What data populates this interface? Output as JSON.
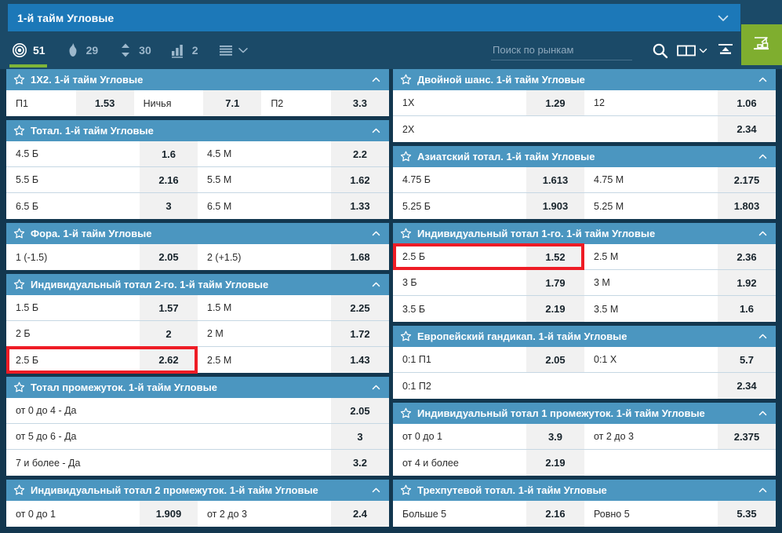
{
  "header": {
    "title": "1-й тайм Угловые",
    "chevron_icon": "chevron-down-icon",
    "tools": [
      {
        "icon": "target-icon",
        "count": "51",
        "active": true
      },
      {
        "icon": "flame-icon",
        "count": "29",
        "active": false
      },
      {
        "icon": "updown-arrows-icon",
        "count": "30",
        "active": false
      },
      {
        "icon": "bar-chart-icon",
        "count": "2",
        "active": false
      }
    ],
    "menu_icon": "hamburger-icon",
    "menu_chevron_icon": "chevron-down-icon",
    "search": {
      "placeholder": "Поиск по рынкам",
      "value": ""
    },
    "search_icon": "search-icon",
    "layout_icon": "two-column-layout-icon",
    "layout_chevron_icon": "chevron-down-icon",
    "collapse_all_icon": "collapse-all-icon",
    "brand_icon": "crane-icon",
    "colors": {
      "bar_bg": "#1b4a68",
      "title_bg": "#1c78b8",
      "accent_green": "#7fb539",
      "brand_green": "#7fae2f",
      "market_header": "#4b96c0",
      "highlight_red": "#ee1c25"
    }
  },
  "left_column": [
    {
      "title": "1X2. 1-й тайм Угловые",
      "layout": "third",
      "rows": [
        [
          {
            "label": "П1",
            "odds": "1.53"
          },
          {
            "label": "Ничья",
            "odds": "7.1"
          },
          {
            "label": "П2",
            "odds": "3.3"
          }
        ]
      ]
    },
    {
      "title": "Тотал. 1-й тайм Угловые",
      "layout": "half",
      "rows": [
        [
          {
            "label": "4.5 Б",
            "odds": "1.6"
          },
          {
            "label": "4.5 М",
            "odds": "2.2"
          }
        ],
        [
          {
            "label": "5.5 Б",
            "odds": "2.16"
          },
          {
            "label": "5.5 М",
            "odds": "1.62"
          }
        ],
        [
          {
            "label": "6.5 Б",
            "odds": "3"
          },
          {
            "label": "6.5 М",
            "odds": "1.33"
          }
        ]
      ]
    },
    {
      "title": "Фора. 1-й тайм Угловые",
      "layout": "half",
      "rows": [
        [
          {
            "label": "1 (-1.5)",
            "odds": "2.05"
          },
          {
            "label": "2 (+1.5)",
            "odds": "1.68"
          }
        ]
      ]
    },
    {
      "title": "Индивидуальный тотал 2-го. 1-й тайм Угловые",
      "layout": "half",
      "rows": [
        [
          {
            "label": "1.5 Б",
            "odds": "1.57"
          },
          {
            "label": "1.5 М",
            "odds": "2.25"
          }
        ],
        [
          {
            "label": "2 Б",
            "odds": "2"
          },
          {
            "label": "2 М",
            "odds": "1.72"
          }
        ],
        [
          {
            "label": "2.5 Б",
            "odds": "2.62",
            "highlight": true
          },
          {
            "label": "2.5 М",
            "odds": "1.43"
          }
        ]
      ]
    },
    {
      "title": "Тотал промежуток. 1-й тайм Угловые",
      "layout": "full",
      "rows": [
        [
          {
            "label": "от 0 до 4 - Да",
            "odds": "2.05"
          }
        ],
        [
          {
            "label": "от 5 до 6 - Да",
            "odds": "3"
          }
        ],
        [
          {
            "label": "7 и более - Да",
            "odds": "3.2"
          }
        ]
      ]
    },
    {
      "title": "Индивидуальный тотал 2 промежуток. 1-й тайм Угловые",
      "layout": "half",
      "rows": [
        [
          {
            "label": "от 0 до 1",
            "odds": "1.909"
          },
          {
            "label": "от 2 до 3",
            "odds": "2.4"
          }
        ]
      ]
    }
  ],
  "right_column": [
    {
      "title": "Двойной шанс. 1-й тайм Угловые",
      "layout": "half",
      "rows": [
        [
          {
            "label": "1X",
            "odds": "1.29"
          },
          {
            "label": "12",
            "odds": "1.06"
          }
        ],
        [
          {
            "label": "2X",
            "odds": "2.34",
            "full": true
          }
        ]
      ]
    },
    {
      "title": "Азиатский тотал. 1-й тайм Угловые",
      "layout": "half",
      "rows": [
        [
          {
            "label": "4.75 Б",
            "odds": "1.613"
          },
          {
            "label": "4.75 М",
            "odds": "2.175"
          }
        ],
        [
          {
            "label": "5.25 Б",
            "odds": "1.903"
          },
          {
            "label": "5.25 М",
            "odds": "1.803"
          }
        ]
      ]
    },
    {
      "title": "Индивидуальный тотал 1-го. 1-й тайм Угловые",
      "layout": "half",
      "rows": [
        [
          {
            "label": "2.5 Б",
            "odds": "1.52",
            "highlight": true
          },
          {
            "label": "2.5 М",
            "odds": "2.36"
          }
        ],
        [
          {
            "label": "3 Б",
            "odds": "1.79"
          },
          {
            "label": "3 М",
            "odds": "1.92"
          }
        ],
        [
          {
            "label": "3.5 Б",
            "odds": "2.19"
          },
          {
            "label": "3.5 М",
            "odds": "1.6"
          }
        ]
      ]
    },
    {
      "title": "Европейский гандикап. 1-й тайм Угловые",
      "layout": "half",
      "rows": [
        [
          {
            "label": "0:1 П1",
            "odds": "2.05"
          },
          {
            "label": "0:1 X",
            "odds": "5.7"
          }
        ],
        [
          {
            "label": "0:1 П2",
            "odds": "2.34",
            "full": true
          }
        ]
      ]
    },
    {
      "title": "Индивидуальный тотал 1 промежуток. 1-й тайм Угловые",
      "layout": "half",
      "rows": [
        [
          {
            "label": "от 0 до 1",
            "odds": "3.9"
          },
          {
            "label": "от 2 до 3",
            "odds": "2.375"
          }
        ],
        [
          {
            "label": "от 4 и более",
            "odds": "2.19"
          },
          {
            "label": "",
            "odds": "",
            "empty": true
          }
        ]
      ]
    },
    {
      "title": "Трехпутевой тотал. 1-й тайм Угловые",
      "layout": "half",
      "rows": [
        [
          {
            "label": "Больше 5",
            "odds": "2.16"
          },
          {
            "label": "Ровно 5",
            "odds": "5.35"
          }
        ]
      ]
    }
  ]
}
